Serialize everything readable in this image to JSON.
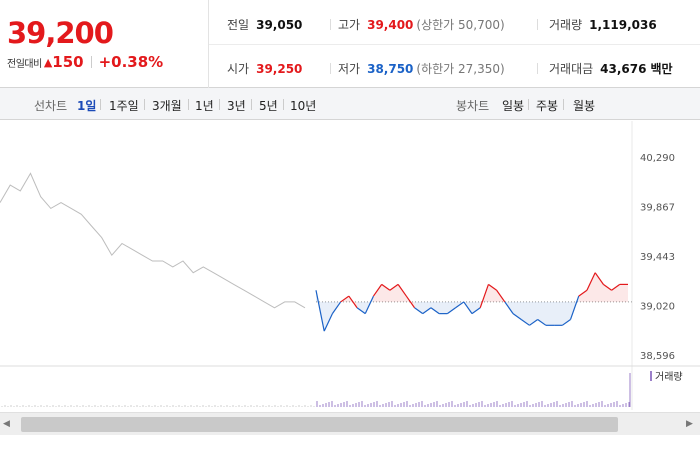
{
  "quote": {
    "current_price": "39,200",
    "change_label": "전일대비",
    "change_value": "150",
    "change_icon": "up-triangle-icon",
    "change_percent": "+0.38%",
    "prev_close": {
      "label": "전일",
      "value": "39,050"
    },
    "open": {
      "label": "시가",
      "value": "39,250"
    },
    "high": {
      "label": "고가",
      "value": "39,400",
      "limit_text": "(상한가 50,700)"
    },
    "low": {
      "label": "저가",
      "value": "38,750",
      "limit_text": "(하한가 27,350)"
    },
    "volume": {
      "label": "거래량",
      "value": "1,119,036"
    },
    "trade_amount": {
      "label": "거래대금",
      "value": "43,676",
      "unit": "백만"
    },
    "colors": {
      "up": "#e3191c",
      "down": "#1b62c7"
    }
  },
  "period_tabs": {
    "line_label": "선차트",
    "line_items": [
      "1일",
      "1주일",
      "3개월",
      "1년",
      "3년",
      "5년",
      "10년"
    ],
    "active": "1일",
    "candle_label": "봉차트",
    "candle_items": [
      "일봉",
      "주봉",
      "월봉"
    ]
  },
  "chart_data": {
    "type": "line",
    "title": "",
    "xlabel": "",
    "ylabel": "",
    "y_ticks": [
      "40,290",
      "39,867",
      "39,443",
      "39,020",
      "38,596"
    ],
    "ylim": [
      38596,
      40290
    ],
    "baseline_prev_close": 39050,
    "series": [
      {
        "name": "",
        "color": "#bdbdbd",
        "values": [
          39900,
          40050,
          40000,
          40150,
          39950,
          39850,
          39900,
          39850,
          39800,
          39700,
          39600,
          39450,
          39550,
          39500,
          39450,
          39400,
          39400,
          39350,
          39400,
          39300,
          39350,
          39300,
          39250,
          39200,
          39150,
          39100,
          39050,
          39000,
          39050,
          39050,
          39000
        ]
      },
      {
        "name": "",
        "color": "#e3191c/#1b62c7",
        "values": [
          39150,
          38800,
          38950,
          39050,
          39100,
          39000,
          38950,
          39100,
          39200,
          39150,
          39200,
          39100,
          39000,
          38950,
          39000,
          38950,
          38950,
          39000,
          39050,
          38950,
          39000,
          39200,
          39150,
          39050,
          38950,
          38900,
          38850,
          38900,
          38850,
          38850,
          38850,
          38900,
          39100,
          39150,
          39300,
          39200,
          39150,
          39200,
          39200
        ]
      }
    ],
    "volume_legend": "거래량",
    "grid": false
  },
  "scrollbar": {
    "left_icon": "scroll-left-arrow-icon",
    "right_icon": "scroll-right-arrow-icon"
  }
}
